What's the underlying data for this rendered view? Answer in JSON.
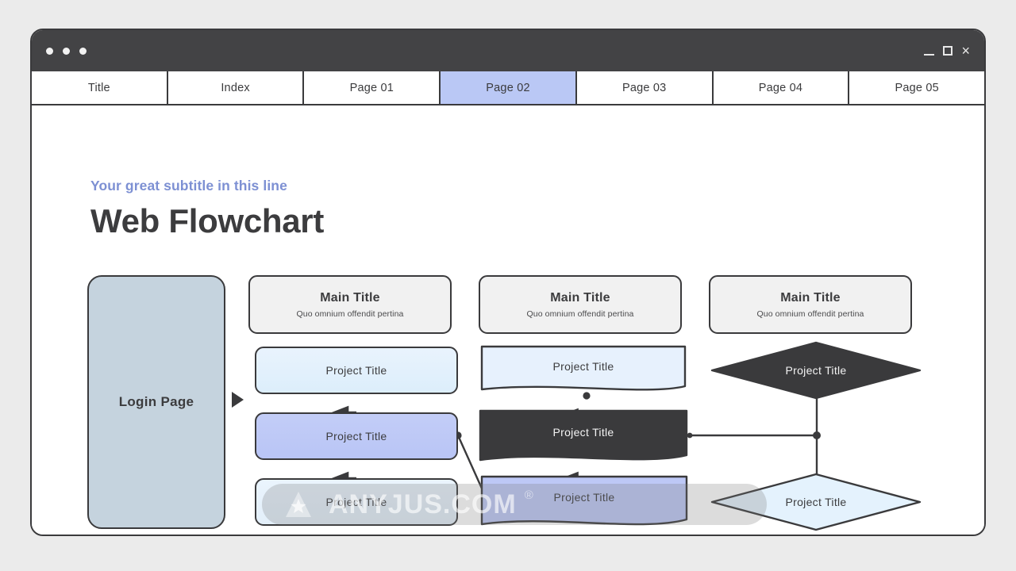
{
  "window": {
    "dots": [
      "dot",
      "dot",
      "dot"
    ],
    "controls": {
      "minimize": "minimize-icon",
      "maximize": "maximize-icon",
      "close": "×"
    }
  },
  "tabs": [
    {
      "label": "Title",
      "active": false
    },
    {
      "label": "Index",
      "active": false
    },
    {
      "label": "Page 01",
      "active": false
    },
    {
      "label": "Page 02",
      "active": true
    },
    {
      "label": "Page 03",
      "active": false
    },
    {
      "label": "Page 04",
      "active": false
    },
    {
      "label": "Page 05",
      "active": false
    }
  ],
  "slide": {
    "subtitle": "Your great subtitle in this line",
    "title": "Web Flowchart"
  },
  "flow": {
    "entry": {
      "label": "Login Page"
    },
    "arrow_icon": "play-triangle-icon",
    "cards": [
      {
        "title": "Main Title",
        "subtitle": "Quo omnium offendit pertina"
      },
      {
        "title": "Main Title",
        "subtitle": "Quo omnium offendit pertina"
      },
      {
        "title": "Main Title",
        "subtitle": "Quo omnium offendit pertina"
      }
    ],
    "column_rounded": [
      {
        "label": "Project Title",
        "style": "light-blue"
      },
      {
        "label": "Project Title",
        "style": "blue"
      },
      {
        "label": "Project Title",
        "style": "light-blue"
      }
    ],
    "column_document": [
      {
        "label": "Project Title",
        "style": "light-blue"
      },
      {
        "label": "Project Title",
        "style": "dark"
      },
      {
        "label": "Project Title",
        "style": "blue"
      }
    ],
    "column_diamond": [
      {
        "label": "Project Title",
        "style": "dark"
      },
      {
        "label": "Project Title",
        "style": "light-blue"
      }
    ]
  },
  "watermark": {
    "text": "ANYJUS.COM",
    "registered": "®",
    "logo": "star-logo-icon"
  },
  "colors": {
    "page_background": "#ebebeb",
    "chrome": "#434345",
    "outline": "#3a3a3c",
    "active_tab": "#bac8f5",
    "subtitle": "#7d90d3",
    "title": "#3c3c3e",
    "entry_fill": "#c5d3de",
    "card_fill": "#f1f1f1",
    "light_blue": "#e4f0fc",
    "blue": "#bdc8f6",
    "dark": "#3a3a3c"
  }
}
